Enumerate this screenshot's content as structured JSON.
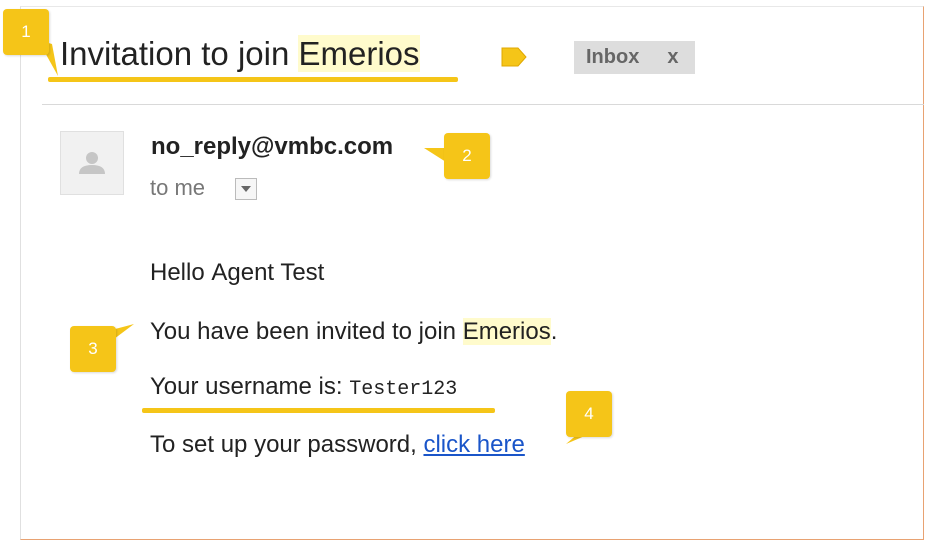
{
  "email": {
    "subject_prefix": "Invitation to join ",
    "subject_highlight": "Emerios",
    "label_chip": "Inbox",
    "label_chip_close": "x",
    "sender": "no_reply@vmbc.com",
    "recipient_line": "to me",
    "body": {
      "greeting": "Hello",
      "greeting_name": "Agent Test",
      "invite_prefix": "You have been invited to join ",
      "invite_highlight": "Emerios",
      "invite_suffix": ".",
      "username_prefix": "Your username is: ",
      "username_value": "Tester123",
      "password_prefix": "To set up your password, ",
      "password_link": "click here"
    }
  },
  "callouts": [
    "1",
    "2",
    "3",
    "4"
  ],
  "colors": {
    "callout": "#f5c518",
    "highlight": "#fffbcc",
    "link": "#1a55c9",
    "label_tag": "#f5c518"
  },
  "icons": {
    "label_tag": "label-tag-icon",
    "avatar": "person-icon",
    "dropdown": "chevron-down-icon"
  }
}
